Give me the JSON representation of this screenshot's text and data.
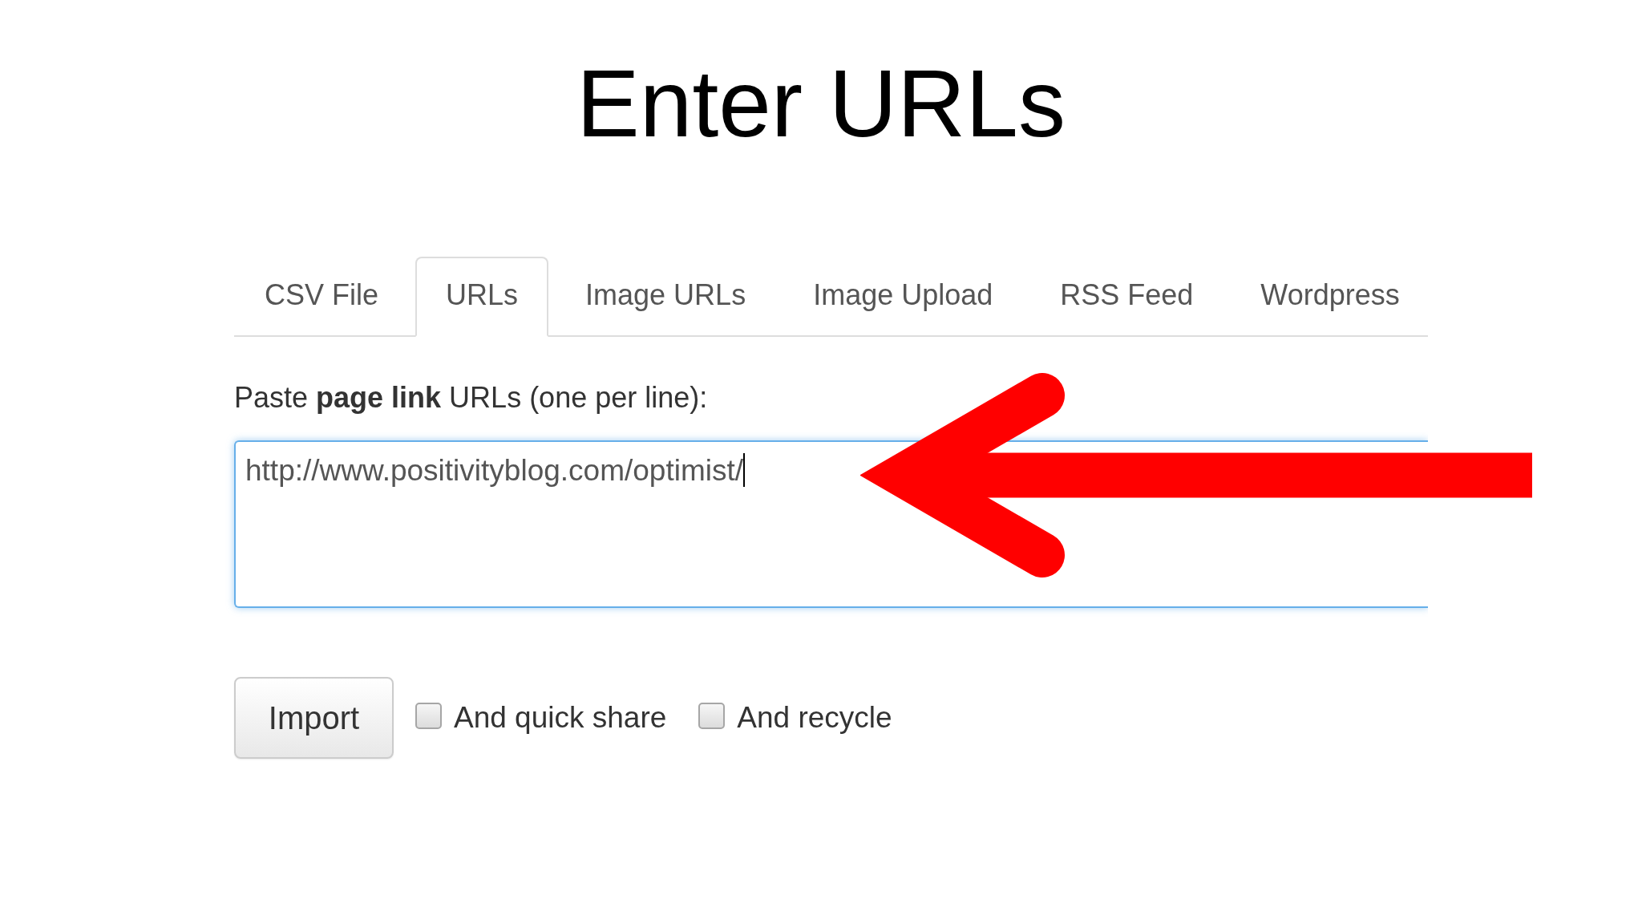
{
  "title": "Enter URLs",
  "tabs": [
    {
      "label": "CSV File",
      "selected": false
    },
    {
      "label": "URLs",
      "selected": true
    },
    {
      "label": "Image URLs",
      "selected": false
    },
    {
      "label": "Image Upload",
      "selected": false
    },
    {
      "label": "RSS Feed",
      "selected": false
    },
    {
      "label": "Wordpress",
      "selected": false
    }
  ],
  "url_field": {
    "label": "Paste **page link** URLs (one per line):",
    "value": "http://www.positivityblog.com/optimist/",
    "focused": true
  },
  "annotation": {
    "kind": "arrow"
  },
  "import_button": "Import",
  "options": [
    {
      "label": "And quick share",
      "checked": false
    },
    {
      "label": "And recycle",
      "checked": false
    }
  ]
}
